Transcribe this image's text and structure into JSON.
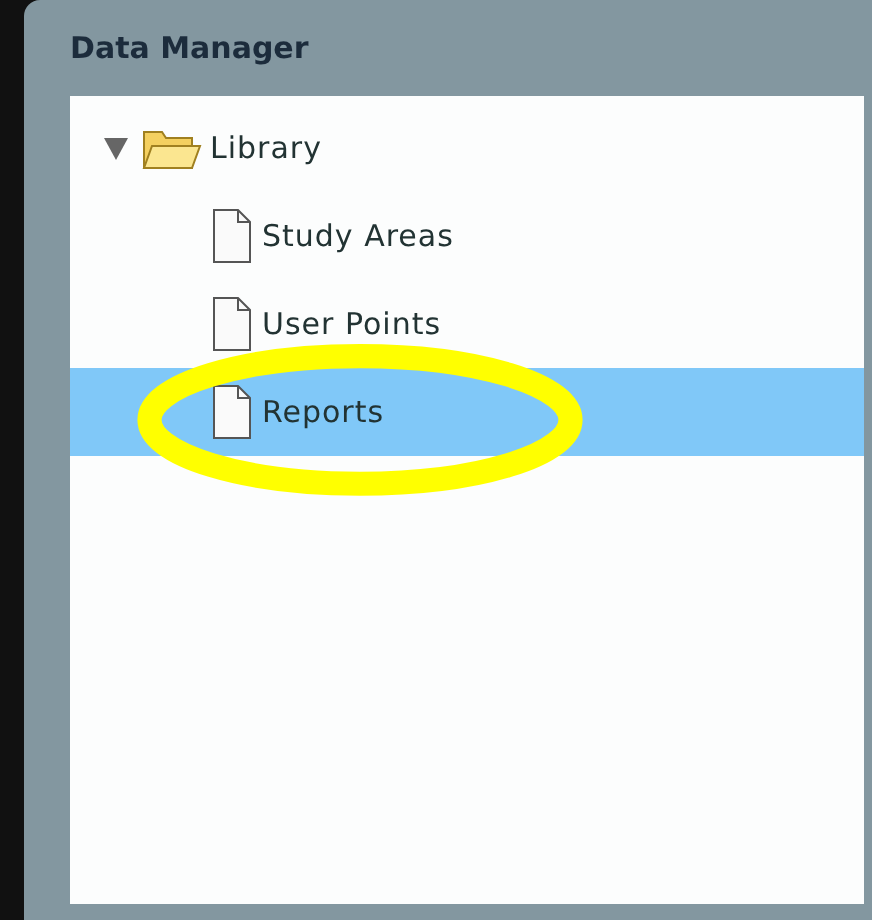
{
  "panel": {
    "title": "Data Manager"
  },
  "tree": [
    {
      "label": "Library",
      "kind": "folder",
      "expanded": true,
      "selected": false,
      "children": [
        {
          "label": "Study Areas",
          "kind": "file",
          "selected": false
        },
        {
          "label": "User Points",
          "kind": "file",
          "selected": false
        },
        {
          "label": "Reports",
          "kind": "file",
          "selected": true
        }
      ]
    }
  ]
}
